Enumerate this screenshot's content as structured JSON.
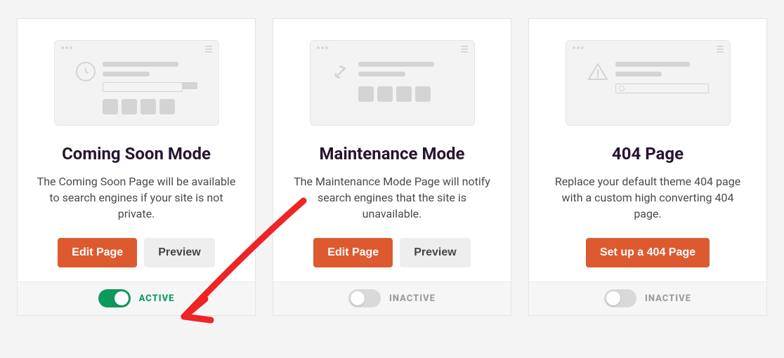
{
  "cards": [
    {
      "title": "Coming Soon Mode",
      "desc": "The Coming Soon Page will be available to search engines if your site is not private.",
      "primary": "Edit Page",
      "secondary": "Preview",
      "active": true,
      "state": "ACTIVE",
      "icon": "clock"
    },
    {
      "title": "Maintenance Mode",
      "desc": "The Maintenance Mode Page will notify search engines that the site is unavailable.",
      "primary": "Edit Page",
      "secondary": "Preview",
      "active": false,
      "state": "INACTIVE",
      "icon": "tools"
    },
    {
      "title": "404 Page",
      "desc": "Replace your default theme 404 page with a custom high converting 404 page.",
      "primary": "Set up a 404 Page",
      "secondary": null,
      "active": false,
      "state": "INACTIVE",
      "icon": "warning"
    }
  ]
}
